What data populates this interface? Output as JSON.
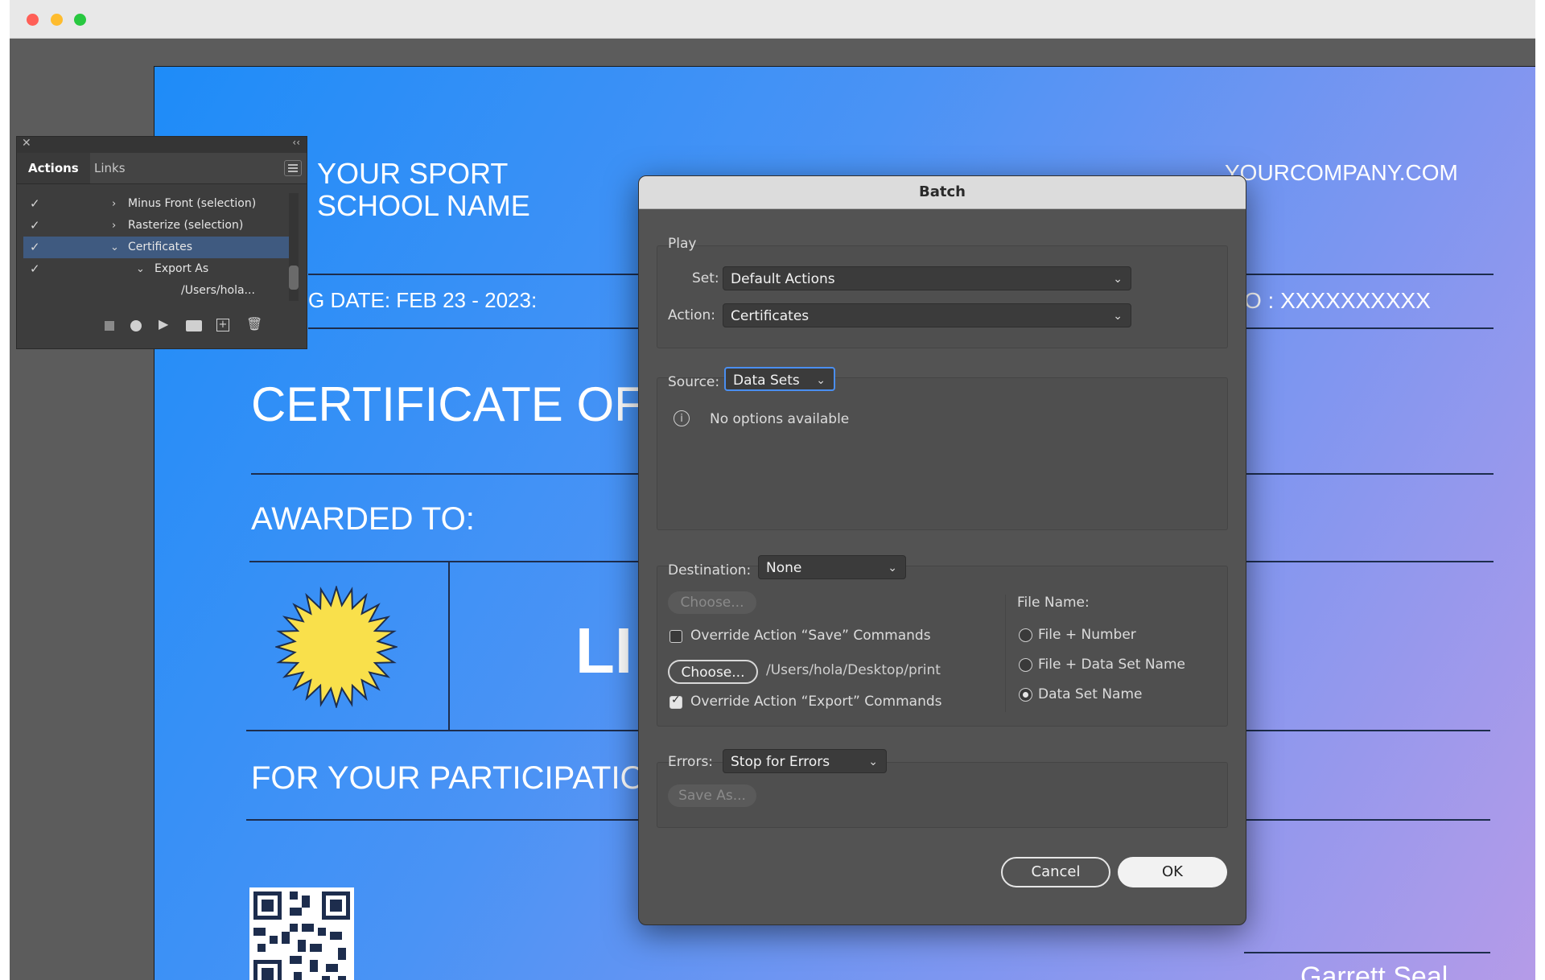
{
  "document": {
    "school_name_line1": "YOUR SPORT",
    "school_name_line2": "SCHOOL NAME",
    "company": "YOURCOMPANY.COM",
    "date": "G DATE: FEB 23 - 2023:",
    "id_text": "O : XXXXXXXXXX",
    "title": "CERTIFICATE OF",
    "awarded": "AWARDED TO:",
    "name_partial": "LI",
    "participation": "FOR YOUR PARTICIPATIO",
    "signature": "Garrett Seal",
    "colors": {
      "gradient_start": "#1e8cf8",
      "gradient_end": "#b59be8",
      "seal": "#f9e04b"
    }
  },
  "actions_panel": {
    "tabs": [
      "Actions",
      "Links"
    ],
    "items": [
      {
        "label": "Minus Front (selection)",
        "checked": true,
        "expanded": false
      },
      {
        "label": "Rasterize (selection)",
        "checked": true,
        "expanded": false
      },
      {
        "label": "Certificates",
        "checked": true,
        "expanded": true,
        "selected": true
      },
      {
        "label": "Export As",
        "checked": true,
        "expanded": true
      },
      {
        "label": "/Users/hola..."
      }
    ]
  },
  "batch": {
    "title": "Batch",
    "play_label": "Play",
    "set_label": "Set:",
    "set_value": "Default Actions",
    "action_label": "Action:",
    "action_value": "Certificates",
    "source_label": "Source:",
    "source_value": "Data Sets",
    "no_options": "No options available",
    "destination_label": "Destination:",
    "destination_value": "None",
    "choose_disabled": "Choose...",
    "override_save": "Override Action “Save” Commands",
    "choose": "Choose...",
    "path": "/Users/hola/Desktop/print",
    "override_export": "Override Action “Export” Commands",
    "file_name_label": "File Name:",
    "file_options": [
      "File + Number",
      "File + Data Set Name",
      "Data Set Name"
    ],
    "file_selected": "Data Set Name",
    "errors_label": "Errors:",
    "errors_value": "Stop for Errors",
    "save_as": "Save As...",
    "cancel": "Cancel",
    "ok": "OK"
  }
}
